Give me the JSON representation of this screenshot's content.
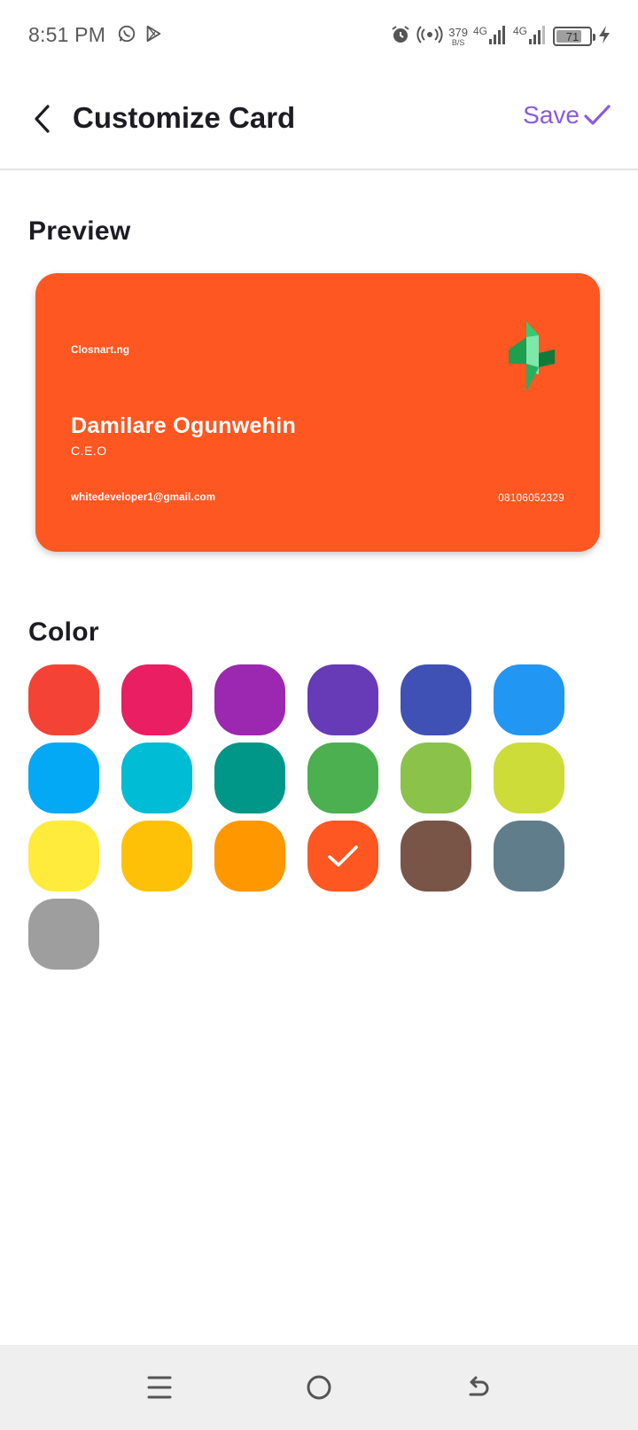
{
  "status_bar": {
    "time": "8:51 PM",
    "net_speed_value": "379",
    "net_speed_unit": "B/S",
    "network_1": "4G",
    "network_2": "4G",
    "battery": "71",
    "icons": [
      "whatsapp-icon",
      "play-store-icon",
      "alarm-icon",
      "hotspot-icon",
      "signal-icon",
      "signal-icon",
      "battery-icon",
      "charging-icon"
    ]
  },
  "app_bar": {
    "title": "Customize Card",
    "save_label": "Save"
  },
  "preview": {
    "title": "Preview"
  },
  "card": {
    "company": "Closnart.ng",
    "name": "Damilare Ogunwehin",
    "role": "C.E.O",
    "email": "whitedeveloper1@gmail.com",
    "phone": "08106052329",
    "background": "#FF5722"
  },
  "color_section": {
    "title": "Color",
    "selected_index": 15,
    "swatches": [
      "#F44336",
      "#E91E63",
      "#9C27B0",
      "#673AB7",
      "#3F51B5",
      "#2196F3",
      "#03A9F4",
      "#00BCD4",
      "#009688",
      "#4CAF50",
      "#8BC34A",
      "#CDDC39",
      "#FFEB3B",
      "#FFC107",
      "#FF9800",
      "#FF5722",
      "#795548",
      "#607D8B",
      "#9E9E9E"
    ]
  },
  "accent_color": "#8A5BE0",
  "nav_bar": {
    "icons": [
      "menu-icon",
      "home-icon",
      "back-icon"
    ]
  }
}
